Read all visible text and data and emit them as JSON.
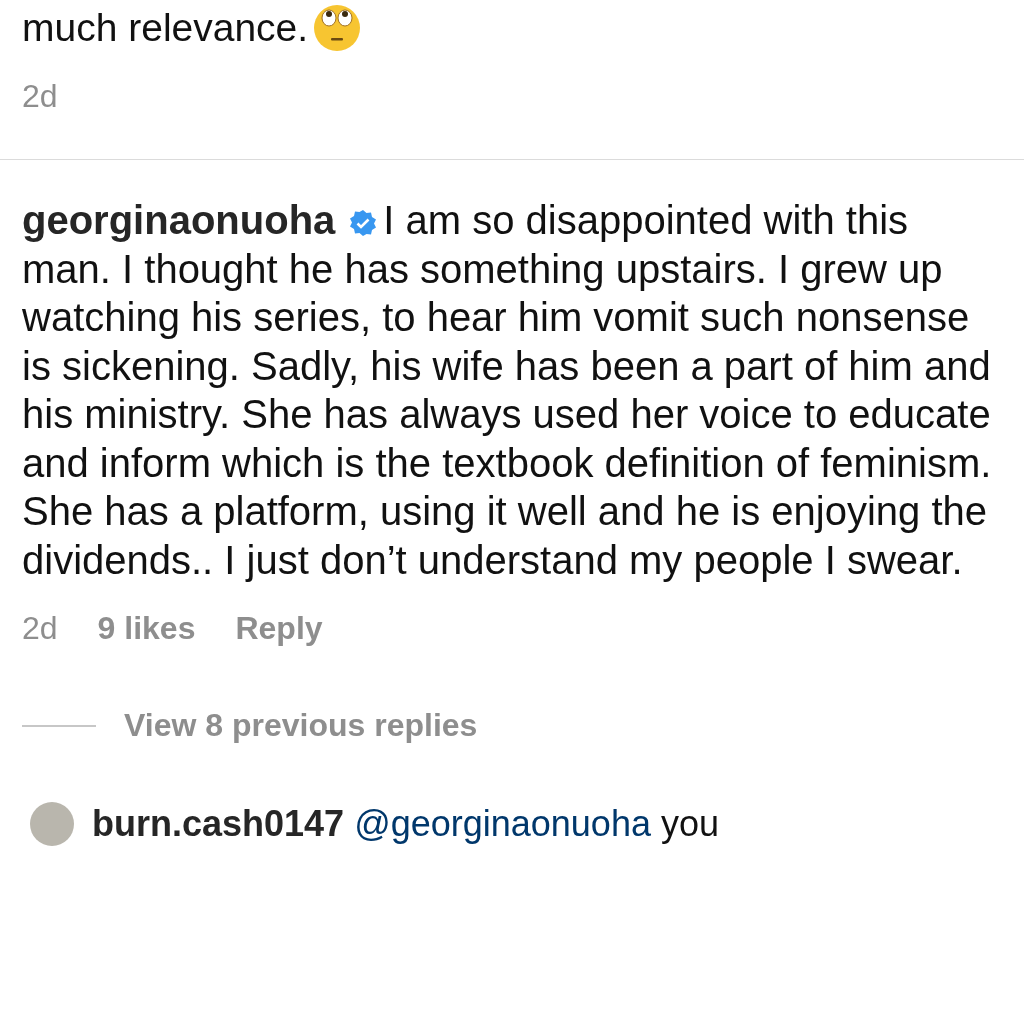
{
  "previous_comment": {
    "text": "much relevance.",
    "time": "2d"
  },
  "comment": {
    "username": "georginaonuoha",
    "verified": true,
    "text": "I am so disappointed with this man. I thought he has something upstairs. I grew up watching his series, to hear him vomit such nonsense is sickening. Sadly, his wife has been a part of him and his ministry. She has always used her voice to educate and inform which is the textbook definition of feminism. She has a platform, using it well and he is enjoying the dividends.. I just don’t understand my people I swear.",
    "time": "2d",
    "likes": "9 likes",
    "reply": "Reply",
    "view_replies": "View 8 previous replies"
  },
  "reply_comment": {
    "username": "burn.cash0147",
    "mention": "@georginaonuoha",
    "text": "you"
  }
}
